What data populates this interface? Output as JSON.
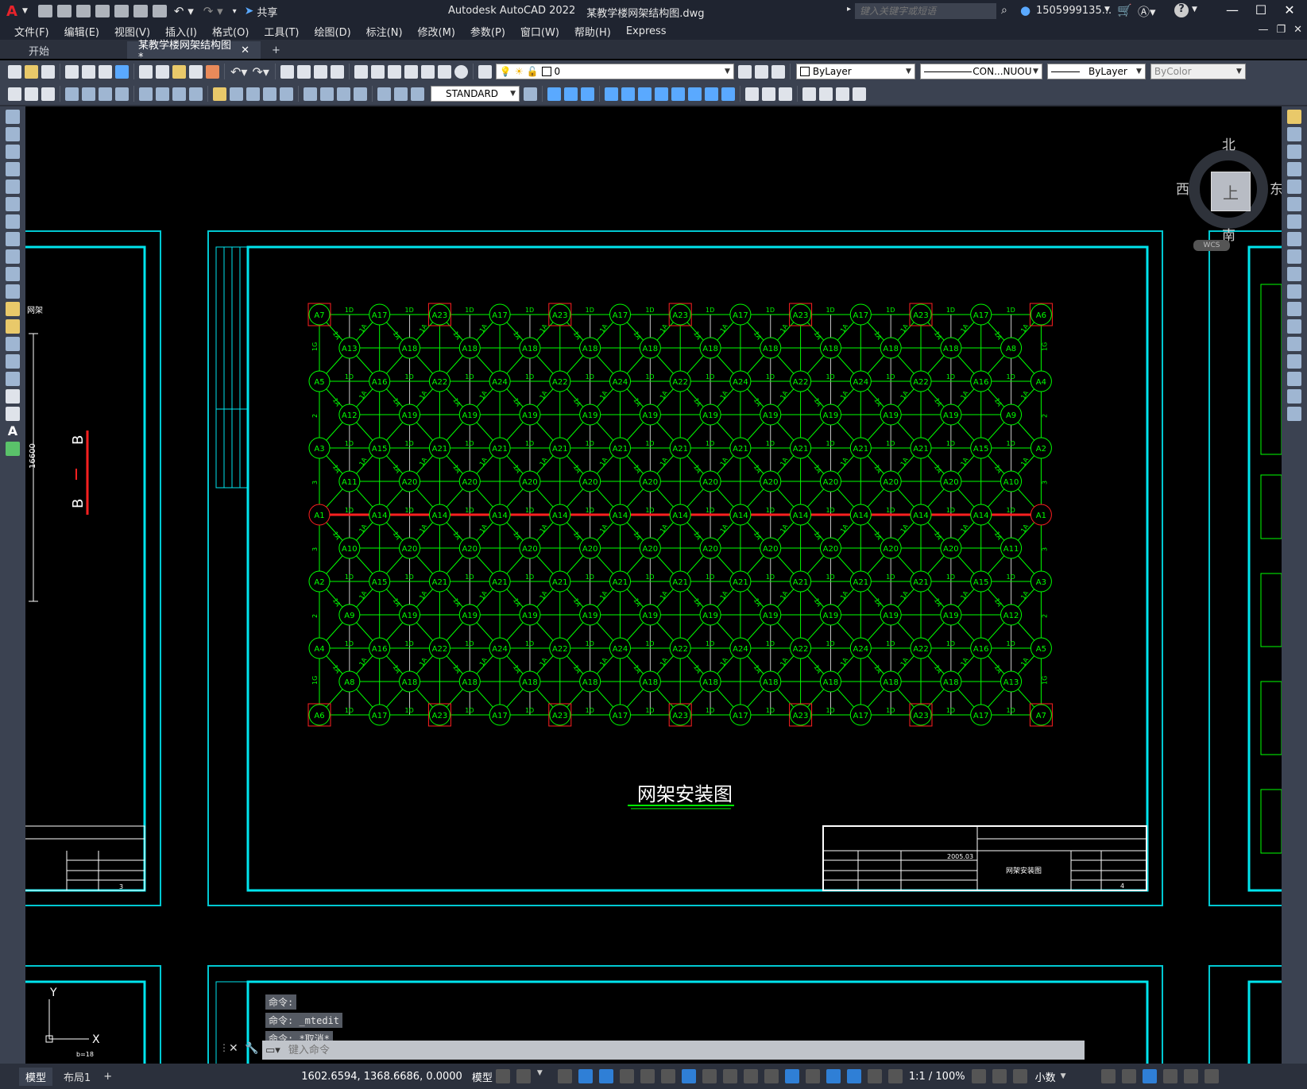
{
  "app": {
    "logo": "A",
    "title": "Autodesk AutoCAD 2022",
    "filename": "某教学楼网架结构图.dwg",
    "share_label": "共享",
    "search_placeholder": "键入关键字或短语",
    "user": "1505999135...",
    "help": "?"
  },
  "menu": [
    "文件(F)",
    "编辑(E)",
    "视图(V)",
    "插入(I)",
    "格式(O)",
    "工具(T)",
    "绘图(D)",
    "标注(N)",
    "修改(M)",
    "参数(P)",
    "窗口(W)",
    "帮助(H)",
    "Express"
  ],
  "tabs": [
    {
      "label": "开始",
      "active": false
    },
    {
      "label": "某教学楼网架结构图*",
      "active": true
    }
  ],
  "toolbar1": {
    "layer_value": "0",
    "color_value": "ByLayer",
    "linetype_value": "CON...NUOU",
    "lineweight_value": "ByLayer",
    "plotstyle_value": "ByColor"
  },
  "toolbar2": {
    "textstyle_value": "STANDARD"
  },
  "viewcube": {
    "north": "北",
    "south": "南",
    "east": "东",
    "west": "西",
    "top": "上",
    "wcs": "WCS"
  },
  "drawing": {
    "title": "网架安装图",
    "left_section": "B — B",
    "left_dim": "16600",
    "left_label": "网架",
    "left_sheet_no": "3",
    "titleblock_sheet_no": "4",
    "titleblock_date": "2005.03",
    "titleblock_name": "网架安装图",
    "ucs_y": "Y",
    "ucs_x": "X",
    "ucs_note": "b=18"
  },
  "grid": {
    "outer_row_top": [
      "A7",
      "A17",
      "A23",
      "A17",
      "A23",
      "A17",
      "A23",
      "A17",
      "A23",
      "A17",
      "A23",
      "A17",
      "A6"
    ],
    "outer_row_2": [
      "A5",
      "A16",
      "A22",
      "A24",
      "A22",
      "A24",
      "A22",
      "A24",
      "A22",
      "A24",
      "A22",
      "A16",
      "A4"
    ],
    "outer_row_3": [
      "A3",
      "A15",
      "A21",
      "A21",
      "A21",
      "A21",
      "A21",
      "A21",
      "A21",
      "A21",
      "A21",
      "A15",
      "A2"
    ],
    "outer_row_mid": [
      "A1",
      "A14",
      "A14",
      "A14",
      "A14",
      "A14",
      "A14",
      "A14",
      "A14",
      "A14",
      "A14",
      "A14",
      "A1"
    ],
    "outer_row_5": [
      "A2",
      "A15",
      "A21",
      "A21",
      "A21",
      "A21",
      "A21",
      "A21",
      "A21",
      "A21",
      "A21",
      "A15",
      "A3"
    ],
    "outer_row_6": [
      "A4",
      "A16",
      "A22",
      "A24",
      "A22",
      "A24",
      "A22",
      "A24",
      "A22",
      "A24",
      "A22",
      "A16",
      "A5"
    ],
    "outer_row_bot": [
      "A6",
      "A17",
      "A23",
      "A17",
      "A23",
      "A17",
      "A23",
      "A17",
      "A23",
      "A17",
      "A23",
      "A17",
      "A7"
    ],
    "inner_row_1": [
      "A13",
      "A18",
      "A18",
      "A18",
      "A18",
      "A18",
      "A18",
      "A18",
      "A18",
      "A18",
      "A18",
      "A8"
    ],
    "inner_row_2": [
      "A12",
      "A19",
      "A19",
      "A19",
      "A19",
      "A19",
      "A19",
      "A19",
      "A19",
      "A19",
      "A19",
      "A9"
    ],
    "inner_row_3": [
      "A11",
      "A20",
      "A20",
      "A20",
      "A20",
      "A20",
      "A20",
      "A20",
      "A20",
      "A20",
      "A20",
      "A10"
    ],
    "inner_row_4": [
      "A10",
      "A20",
      "A20",
      "A20",
      "A20",
      "A20",
      "A20",
      "A20",
      "A20",
      "A20",
      "A20",
      "A11"
    ],
    "inner_row_5": [
      "A9",
      "A19",
      "A19",
      "A19",
      "A19",
      "A19",
      "A19",
      "A19",
      "A19",
      "A19",
      "A19",
      "A12"
    ],
    "inner_row_6": [
      "A8",
      "A18",
      "A18",
      "A18",
      "A18",
      "A18",
      "A18",
      "A18",
      "A18",
      "A18",
      "A18",
      "A13"
    ],
    "bar_label_h": "1D",
    "bar_label_d": "1A",
    "bar_label_v": "1F",
    "side_labels": [
      "1G",
      "2",
      "3",
      "3",
      "2",
      "1G"
    ]
  },
  "command": {
    "history": [
      "命令:",
      "命令: _mtedit",
      "命令: *取消*"
    ],
    "placeholder": "键入命令"
  },
  "status": {
    "layout_tabs": [
      "模型",
      "布局1"
    ],
    "coords": "1602.6594, 1368.6686, 0.0000",
    "space": "模型",
    "scale": "1:1 / 100%",
    "units": "小数"
  }
}
